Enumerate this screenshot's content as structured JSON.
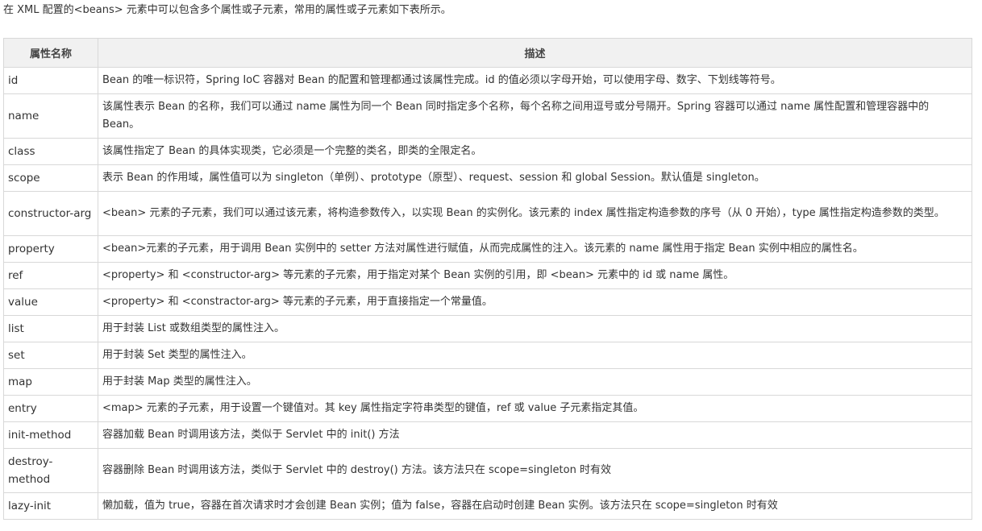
{
  "intro": "在 XML 配置的<beans> 元素中可以包含多个属性或子元素，常用的属性或子元素如下表所示。",
  "table": {
    "headers": [
      "属性名称",
      "描述"
    ],
    "rows": [
      {
        "name": "id",
        "desc": "Bean 的唯一标识符，Spring IoC 容器对 Bean 的配置和管理都通过该属性完成。id 的值必须以字母开始，可以使用字母、数字、下划线等符号。"
      },
      {
        "name": "name",
        "desc": "该属性表示 Bean 的名称，我们可以通过 name 属性为同一个 Bean 同时指定多个名称，每个名称之间用逗号或分号隔开。Spring 容器可以通过 name 属性配置和管理容器中的 Bean。"
      },
      {
        "name": "class",
        "desc": "该属性指定了 Bean 的具体实现类，它必须是一个完整的类名，即类的全限定名。"
      },
      {
        "name": "scope",
        "desc": "表示 Bean 的作用域，属性值可以为 singleton（单例）、prototype（原型）、request、session 和 global Session。默认值是 singleton。"
      },
      {
        "name": "constructor-arg",
        "desc": "<bean> 元素的子元素，我们可以通过该元素，将构造参数传入，以实现 Bean 的实例化。该元素的 index 属性指定构造参数的序号（从 0 开始），type 属性指定构造参数的类型。"
      },
      {
        "name": "property",
        "desc": "<bean>元素的子元素，用于调用 Bean 实例中的 setter 方法对属性进行赋值，从而完成属性的注入。该元素的 name 属性用于指定 Bean 实例中相应的属性名。"
      },
      {
        "name": "ref",
        "desc": "<property> 和 <constructor-arg> 等元素的子元索，用于指定对某个 Bean 实例的引用，即 <bean> 元素中的 id 或 name 属性。"
      },
      {
        "name": "value",
        "desc": "<property> 和 <constractor-arg> 等元素的子元素，用于直接指定一个常量值。"
      },
      {
        "name": "list",
        "desc": "用于封装 List 或数组类型的属性注入。"
      },
      {
        "name": "set",
        "desc": "用于封装 Set 类型的属性注入。"
      },
      {
        "name": "map",
        "desc": "用于封装 Map 类型的属性注入。"
      },
      {
        "name": "entry",
        "desc": " <map> 元素的子元素，用于设置一个键值对。其 key 属性指定字符串类型的键值，ref 或 value 子元素指定其值。"
      },
      {
        "name": "init-method",
        "desc": "容器加载 Bean 时调用该方法，类似于 Servlet 中的 init() 方法"
      },
      {
        "name": "destroy-method",
        "desc": "容器删除 Bean 时调用该方法，类似于 Servlet 中的 destroy() 方法。该方法只在 scope=singleton 时有效"
      },
      {
        "name": "lazy-init",
        "desc": "懒加载，值为 true，容器在首次请求时才会创建 Bean 实例；值为 false，容器在启动时创建 Bean 实例。该方法只在 scope=singleton 时有效"
      }
    ]
  }
}
